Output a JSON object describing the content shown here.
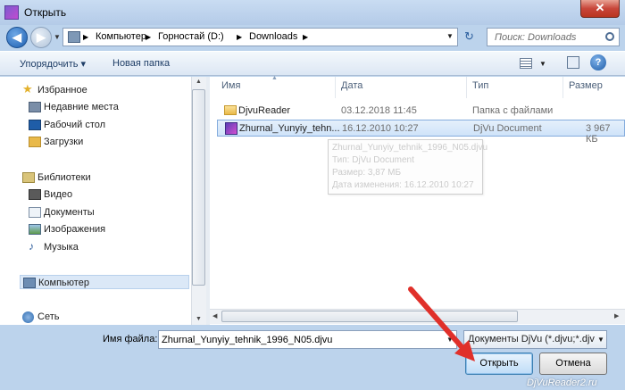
{
  "window": {
    "title": "Открыть",
    "close_symbol": "✕"
  },
  "navigation": {
    "back_symbol": "◀",
    "forward_symbol": "▶",
    "dropdown_symbol": "▼",
    "breadcrumb_separator": "▶",
    "crumbs": [
      "Компьютер",
      "Горностай (D:)",
      "Downloads"
    ],
    "refresh_symbol": "↻",
    "search_placeholder": "Поиск: Downloads"
  },
  "toolbar": {
    "organize_label": "Упорядочить ▾",
    "new_folder_label": "Новая папка",
    "help_symbol": "?"
  },
  "sidebar": {
    "favorites": {
      "label": "Избранное",
      "icon": "star-icon",
      "items": [
        {
          "label": "Недавние места",
          "icon": "recent-places-icon"
        },
        {
          "label": "Рабочий стол",
          "icon": "desktop-icon"
        },
        {
          "label": "Загрузки",
          "icon": "downloads-icon"
        }
      ]
    },
    "libraries": {
      "label": "Библиотеки",
      "icon": "library-icon",
      "items": [
        {
          "label": "Видео",
          "icon": "video-icon"
        },
        {
          "label": "Документы",
          "icon": "documents-icon"
        },
        {
          "label": "Изображения",
          "icon": "images-icon"
        },
        {
          "label": "Музыка",
          "icon": "music-icon"
        }
      ]
    },
    "computer": {
      "label": "Компьютер",
      "icon": "computer-icon"
    },
    "network": {
      "label": "Сеть",
      "icon": "network-icon"
    }
  },
  "file_list": {
    "columns": [
      "Имя",
      "Дата",
      "Тип",
      "Размер"
    ],
    "rows": [
      {
        "name": "DjvuReader",
        "date": "03.12.2018 11:45",
        "type": "Папка с файлами",
        "size": "",
        "icon": "folder-icon"
      },
      {
        "name": "Zhurnal_Yunyiy_tehn...",
        "date": "16.12.2010 10:27",
        "type": "DjVu Document",
        "size": "3 967 КБ",
        "icon": "djvu-file-icon"
      }
    ],
    "tooltip": [
      "Zhurnal_Yunyiy_tehnik_1996_N05.djvu",
      "Тип: DjVu Document",
      "Размер: 3,87 МБ",
      "Дата изменения: 16.12.2010 10:27"
    ]
  },
  "bottom": {
    "filename_label": "Имя файла:",
    "filename_value": "Zhurnal_Yunyiy_tehnik_1996_N05.djvu",
    "filter_value": "Документы DjVu (*.djvu;*.djv",
    "open_label": "Открыть",
    "cancel_label": "Отмена"
  },
  "watermark": "DjVuReader2.ru",
  "colors": {
    "accent_arrow": "#e0302a",
    "selection": "#cfe3f9",
    "frame": "#bcd3ec"
  }
}
